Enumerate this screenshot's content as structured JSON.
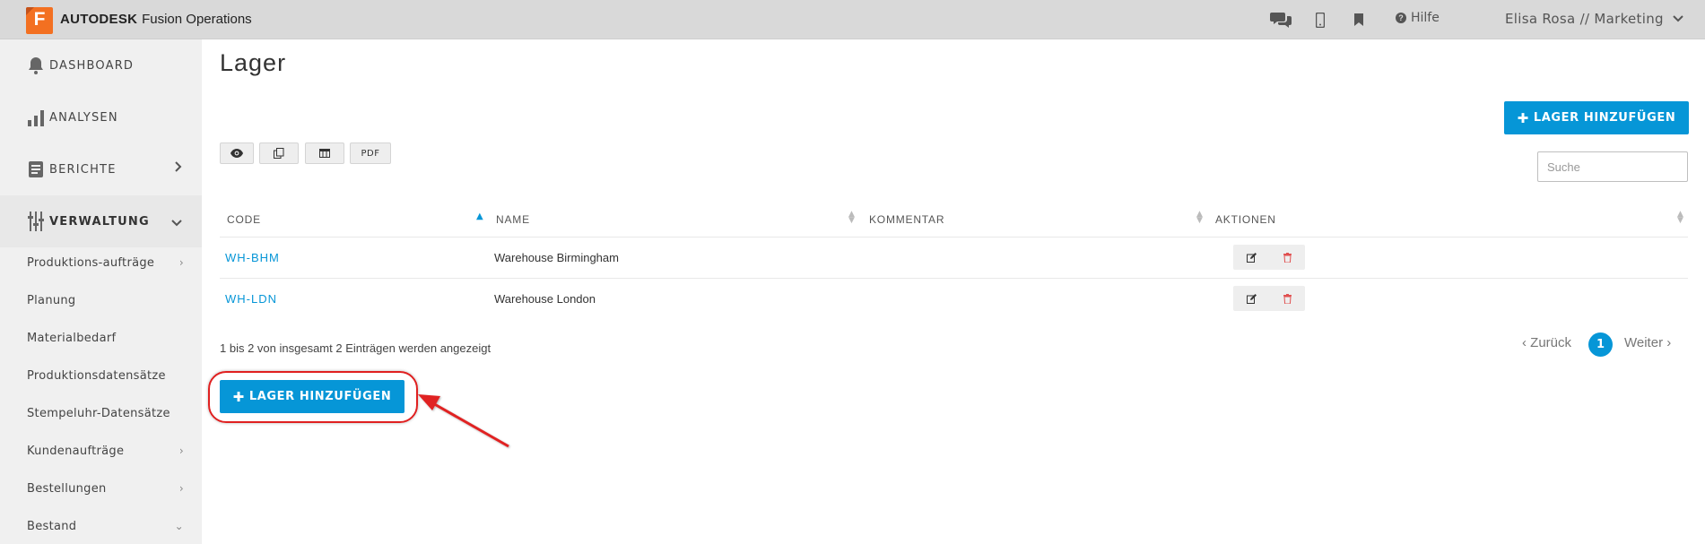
{
  "header": {
    "logo_letter": "F",
    "brand_bold": "AUTODESK",
    "brand_product": "Fusion Operations",
    "help_label": "Hilfe",
    "user_label": "Elisa Rosa // Marketing",
    "icons": [
      "chat-icon",
      "mobile-icon",
      "bookmark-icon",
      "help-icon",
      "chevron-down-icon"
    ]
  },
  "sidebar": {
    "main_items": [
      {
        "label": "DASHBOARD",
        "icon": "bell-icon"
      },
      {
        "label": "ANALYSEN",
        "icon": "bar-chart-icon"
      },
      {
        "label": "BERICHTE",
        "icon": "report-icon"
      },
      {
        "label": "VERWALTUNG",
        "icon": "sliders-icon"
      }
    ],
    "sub_items": [
      {
        "label": "Produktions-aufträge"
      },
      {
        "label": "Planung"
      },
      {
        "label": "Materialbedarf"
      },
      {
        "label": "Produktionsdatensätze"
      },
      {
        "label": "Stempeluhr-Datensätze"
      },
      {
        "label": "Kundenaufträge"
      },
      {
        "label": "Bestellungen"
      },
      {
        "label": "Bestand"
      }
    ]
  },
  "main": {
    "title": "Lager",
    "add_button_label": "LAGER HINZUFÜGEN",
    "toolbar": {
      "pdf_label": "PDF"
    },
    "search": {
      "placeholder": "Suche",
      "value": ""
    },
    "table": {
      "columns": [
        "CODE",
        "NAME",
        "KOMMENTAR",
        "AKTIONEN"
      ],
      "rows": [
        {
          "code": "WH-BHM",
          "name": "Warehouse Birmingham",
          "comment": ""
        },
        {
          "code": "WH-LDN",
          "name": "Warehouse London",
          "comment": ""
        }
      ]
    },
    "info_text": "1 bis 2 von insgesamt 2 Einträgen werden angezeigt",
    "pagination": {
      "prev": "Zurück",
      "current": "1",
      "next": "Weiter"
    }
  },
  "colors": {
    "accent": "#0696d7",
    "brand": "#f37021",
    "annotation": "#e02020"
  }
}
